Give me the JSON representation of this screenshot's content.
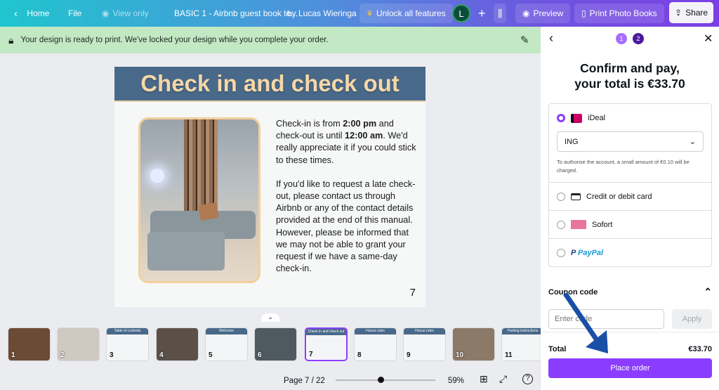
{
  "topbar": {
    "home": "Home",
    "file": "File",
    "view_only": "View only",
    "doc_title": "BASIC 1 - Airbnb guest book te...",
    "author": "by Lucas Wieringa",
    "unlock": "Unlock all features",
    "avatar_initial": "L",
    "preview": "Preview",
    "print": "Print Photo Books",
    "share": "Share"
  },
  "banner": {
    "message": "Your design is ready to print. We've locked your design while you complete your order."
  },
  "slide": {
    "title": "Check in and check out",
    "p1_a": "Check-in is from ",
    "p1_b": "2:00 pm",
    "p1_c": " and check-out is until ",
    "p1_d": "12:00 am",
    "p1_e": ". We'd really appreciate it if you could stick to these times.",
    "p2": "If you'd like to request a late check-out, please contact us through Airbnb or any of the contact details provided at the end of this manual. However, please be informed that we may not be able to grant your request if we have a same-day check-in.",
    "page_number": "7"
  },
  "thumbnails": [
    {
      "n": "1",
      "title": ""
    },
    {
      "n": "2",
      "title": ""
    },
    {
      "n": "3",
      "title": "Table of contents"
    },
    {
      "n": "4",
      "title": ""
    },
    {
      "n": "5",
      "title": "Welcome"
    },
    {
      "n": "6",
      "title": ""
    },
    {
      "n": "7",
      "title": "Check in and check out"
    },
    {
      "n": "8",
      "title": "House rules"
    },
    {
      "n": "9",
      "title": "House rules"
    },
    {
      "n": "10",
      "title": ""
    },
    {
      "n": "11",
      "title": "Parking instructions"
    }
  ],
  "footer": {
    "page": "Page 7 / 22",
    "zoom": "59%",
    "zoom_level": 59
  },
  "panel": {
    "step1": "1",
    "step2": "2",
    "title1": "Confirm and pay,",
    "title2": "your total is €33.70",
    "ideal": "iDeal",
    "bank": "ING",
    "note": "To authorise the account, a small amount of €0.10 will be charged.",
    "card": "Credit or debit card",
    "sofort": "Sofort",
    "paypal": "PayPal",
    "coupon_label": "Coupon code",
    "coupon_placeholder": "Enter code",
    "apply": "Apply",
    "total_label": "Total",
    "total_value": "€33.70",
    "place_order": "Place order"
  },
  "colors": {
    "accent": "#8b3dff",
    "banner": "#c2e8c4",
    "slide_header": "#48698a",
    "annotation_arrow": "#1a4fa8"
  }
}
